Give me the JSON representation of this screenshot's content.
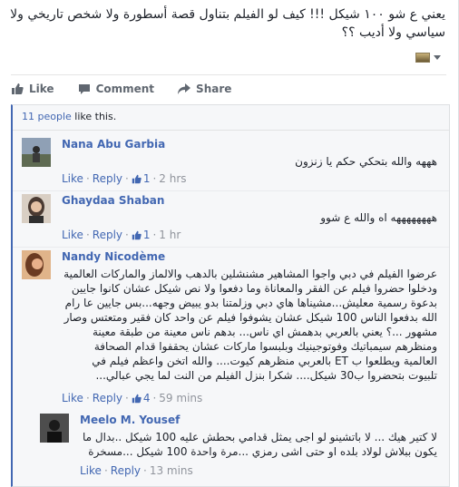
{
  "post": {
    "text": "يعني ع شو ١٠٠ شيكل !!! كيف لو الفيلم بتناول قصة أسطورة ولا شخص تاريخي ولا سياسي ولا أديب ؟؟"
  },
  "actions": [
    {
      "label": "Like",
      "icon": "thumbs-up-icon"
    },
    {
      "label": "Comment",
      "icon": "comment-icon"
    },
    {
      "label": "Share",
      "icon": "share-icon"
    }
  ],
  "likes_summary": {
    "count": "11 people",
    "suffix": " like this."
  },
  "meta_labels": {
    "like": "Like",
    "reply": "Reply",
    "separator": "·"
  },
  "comments": [
    {
      "name": "Nana Abu Garbia",
      "text": "هههه والله بتحكي حكم يا زنزون",
      "likes": "1",
      "time": "2 hrs",
      "avatar_colors": [
        "#7a8aa0",
        "#3a3f36"
      ]
    },
    {
      "name": "Ghaydaa Shaban",
      "text": "ههههههههه اه والله ع شوو",
      "likes": "1",
      "time": "1 hr",
      "avatar_colors": [
        "#c9b8a5",
        "#4a3a32"
      ]
    },
    {
      "name": "Nandy Nicodème",
      "text": "عرضوا الفيلم في دبي واجوا المشاهير مشنشلين بالدهب والالماز والماركات العالمية ودخلوا حضروا فيلم عن الفقر والمعاناة وما دفعوا ولا نص شيكل عشان كانوا جايين بدعوة رسمية معليش...مشيناها هاي دبي وزلمتنا بدو يبيض وجهه...بس جايين عا رام الله بدفعوا الناس 100 شيكل عشان يشوفوا فيلم عن واحد كان فقير ومتعتس وصار مشهور ...؟ يعني بالعربي بدهمش اي ناس... بدهم ناس معينة من طبقة معينة ومنظرهم سيمباتيك وفوتوجينيك وبلبسوا ماركات عشان يحقفوا قدام الصحافة العالمية ويطلعوا ب ET بالعربي منظرهم كيوت.... والله اتخن واعظم فيلم في تلبيوت بتحضروا ب30 شيكل.... شكرا بنزل الفيلم من النت لما يجي عبالي...",
      "likes": "4",
      "time": "59 mins",
      "avatar_colors": [
        "#d8a77a",
        "#5a3420"
      ]
    },
    {
      "name": "Meelo M. Yousef",
      "text": "لا كتير هيك ... لا باتشينو لو اجى يمثل قدامي بحطش عليه 100 شيكل ..بدال ما يكون ببلاش لولاد بلده او حتى اشى رمزي ...مرة واحدة 100 شيكل ...مسخرة",
      "likes": "",
      "time": "13 mins",
      "avatar_colors": [
        "#4d4d4d",
        "#151515"
      ]
    }
  ],
  "colors": {
    "link": "#4267b2",
    "meta": "#90949c",
    "accent_bar": "#4267b2"
  }
}
